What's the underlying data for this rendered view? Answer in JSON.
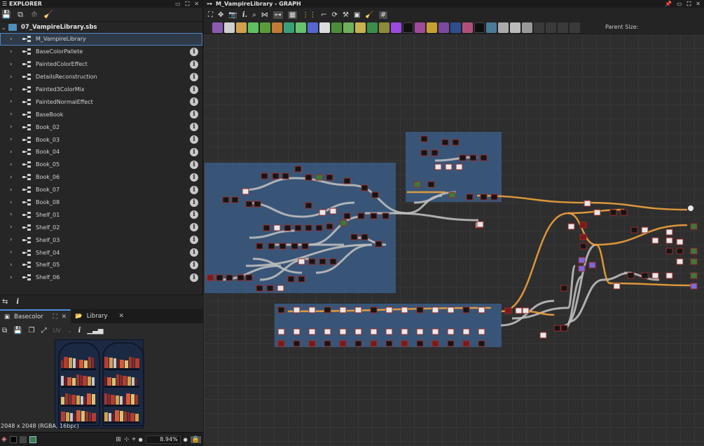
{
  "explorer": {
    "title": "EXPLORER",
    "package": "07_VampireLibrary.sbs",
    "items": [
      {
        "label": "M_VampireLibrary",
        "selected": true
      },
      {
        "label": "BaseColorPallete"
      },
      {
        "label": "PaintedColorEffect"
      },
      {
        "label": "DetailsReconstruction"
      },
      {
        "label": "Painted3ColorMix"
      },
      {
        "label": "PaintedNormalEffect"
      },
      {
        "label": "BaseBook"
      },
      {
        "label": "Book_02"
      },
      {
        "label": "Book_03"
      },
      {
        "label": "Book_04"
      },
      {
        "label": "Book_05"
      },
      {
        "label": "Book_06"
      },
      {
        "label": "Book_07"
      },
      {
        "label": "Book_08"
      },
      {
        "label": "Shelf_01"
      },
      {
        "label": "Shelf_02"
      },
      {
        "label": "Shelf_03"
      },
      {
        "label": "Shelf_04"
      },
      {
        "label": "Shelf_05"
      },
      {
        "label": "Shelf_06"
      }
    ]
  },
  "preview": {
    "tab_basecolor": "Basecolor",
    "tab_library": "Library",
    "uv_label": "UV",
    "info_glyph": "i",
    "resolution": "2048 x 2048 (RGBA, 16bpc)",
    "zoom": "8.94%"
  },
  "graph": {
    "title": "M_VampireLibrary - GRAPH",
    "parent_size_label": "Parent Size:"
  },
  "colors": {
    "frame_blue": "#3a5a80",
    "link_orange": "#f0a23c",
    "link_grey": "#bdbdbd",
    "selection_blue": "#4f84c4"
  },
  "icons": [
    "graph-icon",
    "info-icon",
    "chevron-right-icon",
    "close-icon",
    "pin-icon",
    "maximize-icon",
    "camera-icon",
    "search-icon",
    "layers-icon",
    "histogram-icon"
  ]
}
